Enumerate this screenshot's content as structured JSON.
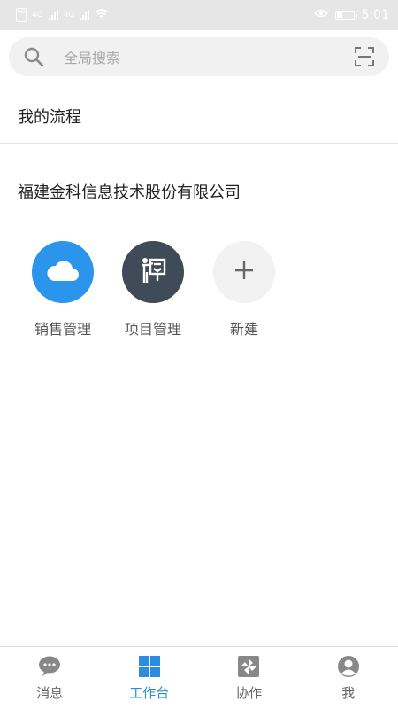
{
  "status_bar": {
    "time": "5:01",
    "left_labels": [
      "HD",
      "4G",
      "4G"
    ]
  },
  "search": {
    "placeholder": "全局搜索"
  },
  "my_flow": {
    "label": "我的流程"
  },
  "company": {
    "name": "福建金科信息技术股份有限公司"
  },
  "apps": [
    {
      "label": "销售管理",
      "icon": "cloud-icon",
      "color": "#2a95ea"
    },
    {
      "label": "项目管理",
      "icon": "presentation-icon",
      "color": "#3f4b57"
    },
    {
      "label": "新建",
      "icon": "plus-icon",
      "color": "#f2f2f2"
    }
  ],
  "nav": {
    "items": [
      {
        "label": "消息",
        "icon": "chat-bubble-icon"
      },
      {
        "label": "工作台",
        "icon": "grid-icon",
        "active": true
      },
      {
        "label": "协作",
        "icon": "pinwheel-icon"
      },
      {
        "label": "我",
        "icon": "user-icon"
      }
    ],
    "active_color": "#2a8de0",
    "inactive_color": "#666666"
  }
}
